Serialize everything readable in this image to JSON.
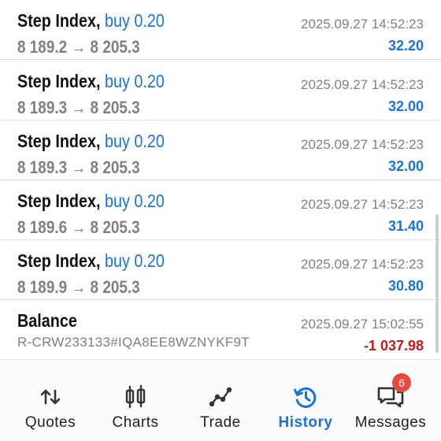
{
  "deals": [
    {
      "symbol": "Step Index,",
      "side": "buy 0.20",
      "prices": "8 189.2 → 8 205.3",
      "time": "2025.09.27 14:52:23",
      "profit": "32.20"
    },
    {
      "symbol": "Step Index,",
      "side": "buy 0.20",
      "prices": "8 189.3 → 8 205.3",
      "time": "2025.09.27 14:52:23",
      "profit": "32.00"
    },
    {
      "symbol": "Step Index,",
      "side": "buy 0.20",
      "prices": "8 189.3 → 8 205.3",
      "time": "2025.09.27 14:52:23",
      "profit": "32.00"
    },
    {
      "symbol": "Step Index,",
      "side": "buy 0.20",
      "prices": "8 189.6 → 8 205.3",
      "time": "2025.09.27 14:52:23",
      "profit": "31.40"
    },
    {
      "symbol": "Step Index,",
      "side": "buy 0.20",
      "prices": "8 189.9 → 8 205.3",
      "time": "2025.09.27 14:52:23",
      "profit": "30.80"
    }
  ],
  "balance": {
    "title": "Balance",
    "comment": "R-CRW233133#IQA8EE8WZNYKF9T",
    "time": "2025.09.27 15:02:55",
    "amount": "-1 037.98"
  },
  "nav": {
    "items": [
      {
        "label": "Quotes",
        "icon": "quotes-icon"
      },
      {
        "label": "Charts",
        "icon": "charts-icon"
      },
      {
        "label": "Trade",
        "icon": "trade-icon"
      },
      {
        "label": "History",
        "icon": "history-icon"
      },
      {
        "label": "Messages",
        "icon": "messages-icon"
      }
    ],
    "active": "History",
    "messages_badge": "6"
  },
  "colors": {
    "accent": "#1a73d9",
    "negative": "#c21b1b",
    "muted": "#808080",
    "badge": "#e64a3d"
  }
}
